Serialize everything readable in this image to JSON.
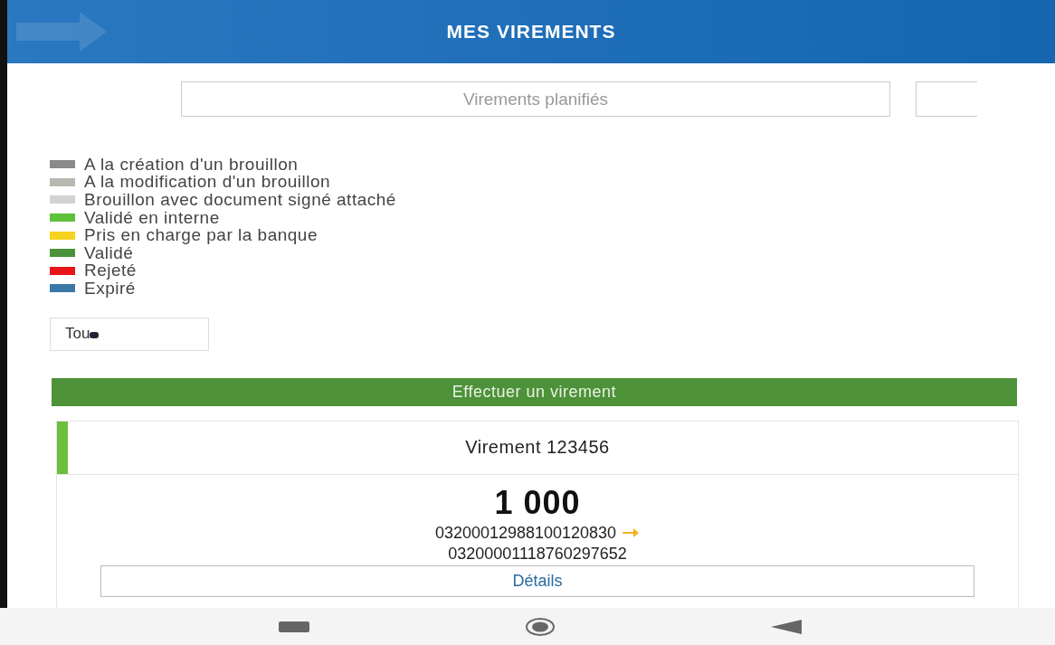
{
  "header": {
    "title": "MES VIREMENTS"
  },
  "tabs": [
    {
      "label": "Virements planifiés",
      "selected": false
    },
    {
      "selected": false
    }
  ],
  "legend": [
    {
      "label": "A la création d'un brouillon",
      "color": "#8a8a8a"
    },
    {
      "label": "A la modification d'un brouillon",
      "color": "#b9b8b0"
    },
    {
      "label": "Brouillon avec document signé attaché",
      "color": "#d2d2d2"
    },
    {
      "label": "Validé en interne",
      "color": "#5ec13a"
    },
    {
      "label": "Pris en charge par la banque",
      "color": "#f5d31e"
    },
    {
      "label": "Validé",
      "color": "#4a923a"
    },
    {
      "label": "Rejeté",
      "color": "#e8141a"
    },
    {
      "label": "Expiré",
      "color": "#3a78a8"
    }
  ],
  "filter": {
    "value": "Tou"
  },
  "action_button": "Effectuer un virement",
  "transfer": {
    "title": "Virement 123456",
    "amount": "1 000",
    "from_account": "03200012988100120830",
    "to_account": "03200001118760297652",
    "details_button": "Détails",
    "color": "#6cbf3c"
  }
}
